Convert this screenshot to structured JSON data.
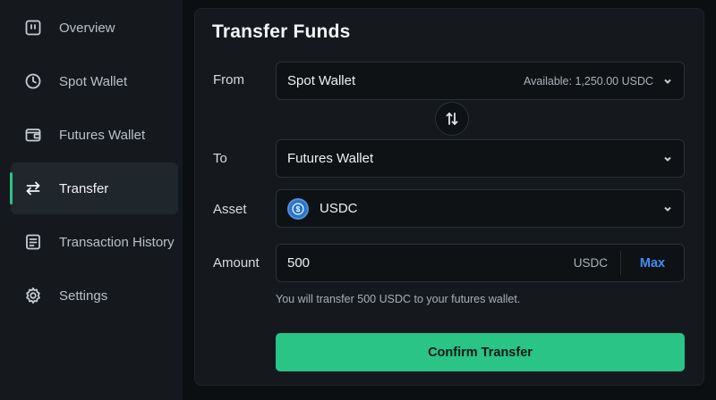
{
  "sidebar": {
    "items": [
      {
        "label": "Overview",
        "icon": "overview-icon"
      },
      {
        "label": "Spot Wallet",
        "icon": "clock-icon"
      },
      {
        "label": "Futures Wallet",
        "icon": "wallet-icon"
      },
      {
        "label": "Transfer",
        "icon": "transfer-icon",
        "active": true
      },
      {
        "label": "Transaction History",
        "icon": "history-icon"
      },
      {
        "label": "Settings",
        "icon": "gear-icon"
      }
    ],
    "accent": "#2fbf86"
  },
  "transfer": {
    "title": "Transfer Funds",
    "from_label": "From",
    "from_value": "Spot Wallet",
    "available_text": "Available: 1,250.00 USDC",
    "to_label": "To",
    "to_value": "Futures Wallet",
    "asset_label": "Asset",
    "asset_value": "USDC",
    "asset_icon": "usdc-coin-icon",
    "amount_label": "Amount",
    "amount_value": "500",
    "amount_unit": "USDC",
    "max_label": "Max",
    "hint": "You will transfer 500 USDC to your futures wallet.",
    "confirm_label": "Confirm Transfer",
    "confirm_color": "#29c486"
  }
}
